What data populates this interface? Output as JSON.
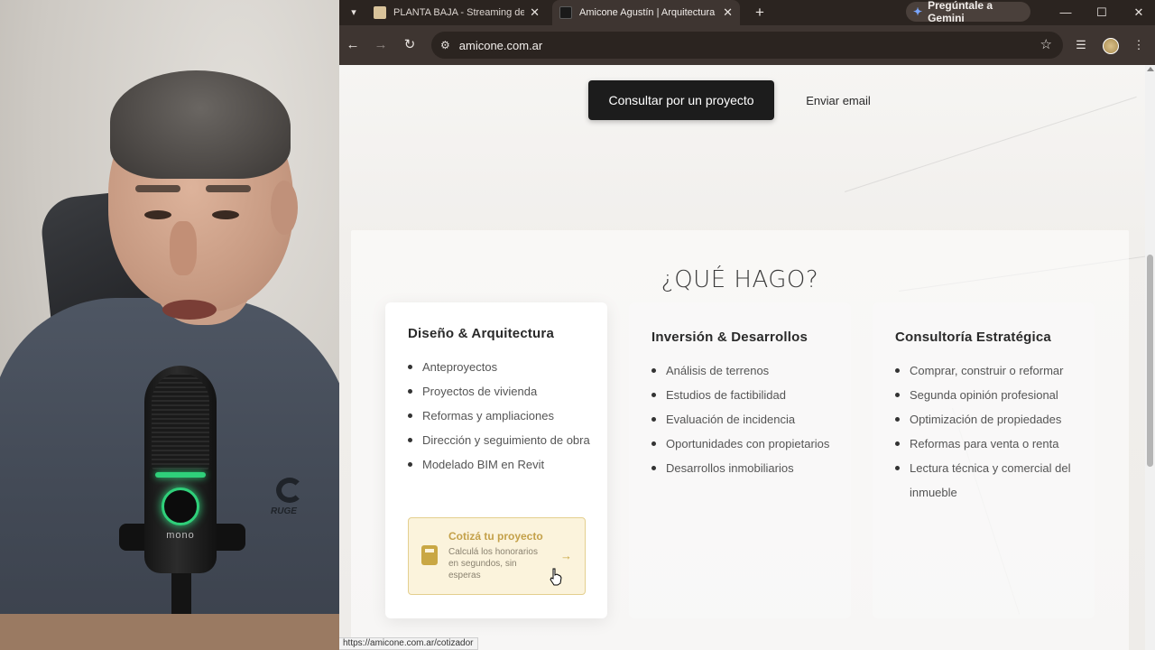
{
  "browser": {
    "tabs": [
      {
        "title": "PLANTA BAJA - Streaming de A",
        "active": false
      },
      {
        "title": "Amicone Agustín | Arquitectura",
        "active": true
      }
    ],
    "gemini_label": "Pregúntale a Gemini",
    "url": "amicone.com.ar",
    "status_url": "https://amicone.com.ar/cotizador"
  },
  "page": {
    "cta_primary": "Consultar por un proyecto",
    "cta_secondary": "Enviar email",
    "section_title": "¿QUÉ HAGO?",
    "cards": [
      {
        "title": "Diseño & Arquitectura",
        "items": [
          "Anteproyectos",
          "Proyectos de vivienda",
          "Reformas y ampliaciones",
          "Dirección y seguimiento de obra",
          "Modelado BIM en Revit"
        ]
      },
      {
        "title": "Inversión & Desarrollos",
        "items": [
          "Análisis de terrenos",
          "Estudios de factibilidad",
          "Evaluación de incidencia",
          "Oportunidades con propietarios",
          "Desarrollos inmobiliarios"
        ]
      },
      {
        "title": "Consultoría Estratégica",
        "items": [
          "Comprar, construir o reformar",
          "Segunda opinión profesional",
          "Optimización de propiedades",
          "Reformas para venta o renta",
          "Lectura técnica y comercial del inmueble"
        ]
      }
    ],
    "quote_box": {
      "title": "Cotizá tu proyecto",
      "description": "Calculá los honorarios en segundos, sin esperas",
      "arrow": "→"
    }
  },
  "webcam": {
    "mic_label": "mono",
    "shirt_logo": "RUGE"
  },
  "colors": {
    "tab_strip": "#2b2420",
    "toolbar": "#3e3531",
    "cta_primary_bg": "#1c1c1c",
    "quote_accent": "#c4a14a"
  }
}
